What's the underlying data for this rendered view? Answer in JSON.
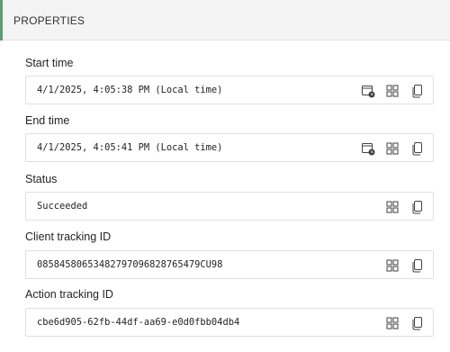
{
  "panel": {
    "title": "PROPERTIES"
  },
  "fields": [
    {
      "label": "Start time",
      "value": "4/1/2025, 4:05:38 PM (Local time)",
      "icons": [
        "time-icon",
        "grid-icon",
        "copy-icon"
      ]
    },
    {
      "label": "End time",
      "value": "4/1/2025, 4:05:41 PM (Local time)",
      "icons": [
        "time-icon",
        "grid-icon",
        "copy-icon"
      ]
    },
    {
      "label": "Status",
      "value": "Succeeded",
      "icons": [
        "grid-icon",
        "copy-icon"
      ]
    },
    {
      "label": "Client tracking ID",
      "value": "08584580653482797096828765479CU98",
      "icons": [
        "grid-icon",
        "copy-icon"
      ]
    },
    {
      "label": "Action tracking ID",
      "value": "cbe6d905-62fb-44df-aa69-e0d0fbb04db4",
      "icons": [
        "grid-icon",
        "copy-icon"
      ]
    }
  ],
  "colors": {
    "accent": "#5a9e6f",
    "border": "#e1e1e1",
    "header_bg": "#f4f4f4"
  }
}
